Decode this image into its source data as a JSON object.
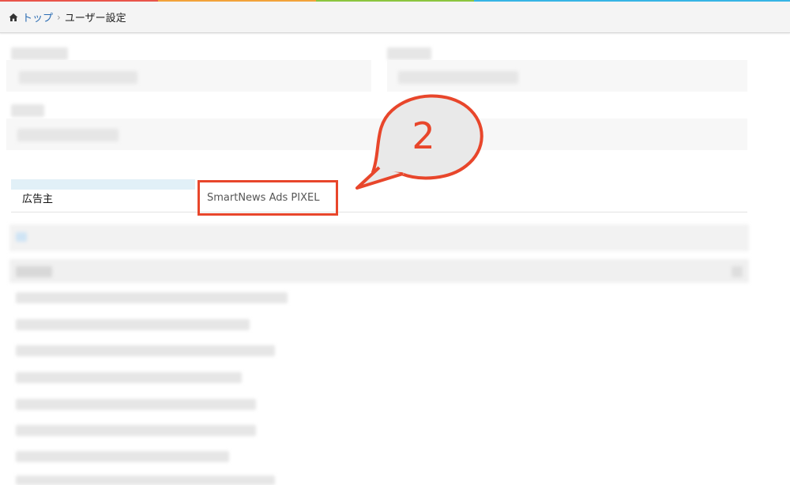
{
  "colors": {
    "accent_red": "#e8462b",
    "link_blue": "#2a6cb3",
    "topline": [
      "#e9554a",
      "#f2a33a",
      "#8cc63f",
      "#36b5e5",
      "#36b5e5"
    ]
  },
  "breadcrumb": {
    "home_icon": "home-icon",
    "home_label": "トップ",
    "separator": "›",
    "current": "ユーザー設定"
  },
  "tabs": [
    {
      "label": "広告主"
    },
    {
      "label": "SmartNews Ads PIXEL"
    }
  ],
  "callout": {
    "number": "2"
  }
}
